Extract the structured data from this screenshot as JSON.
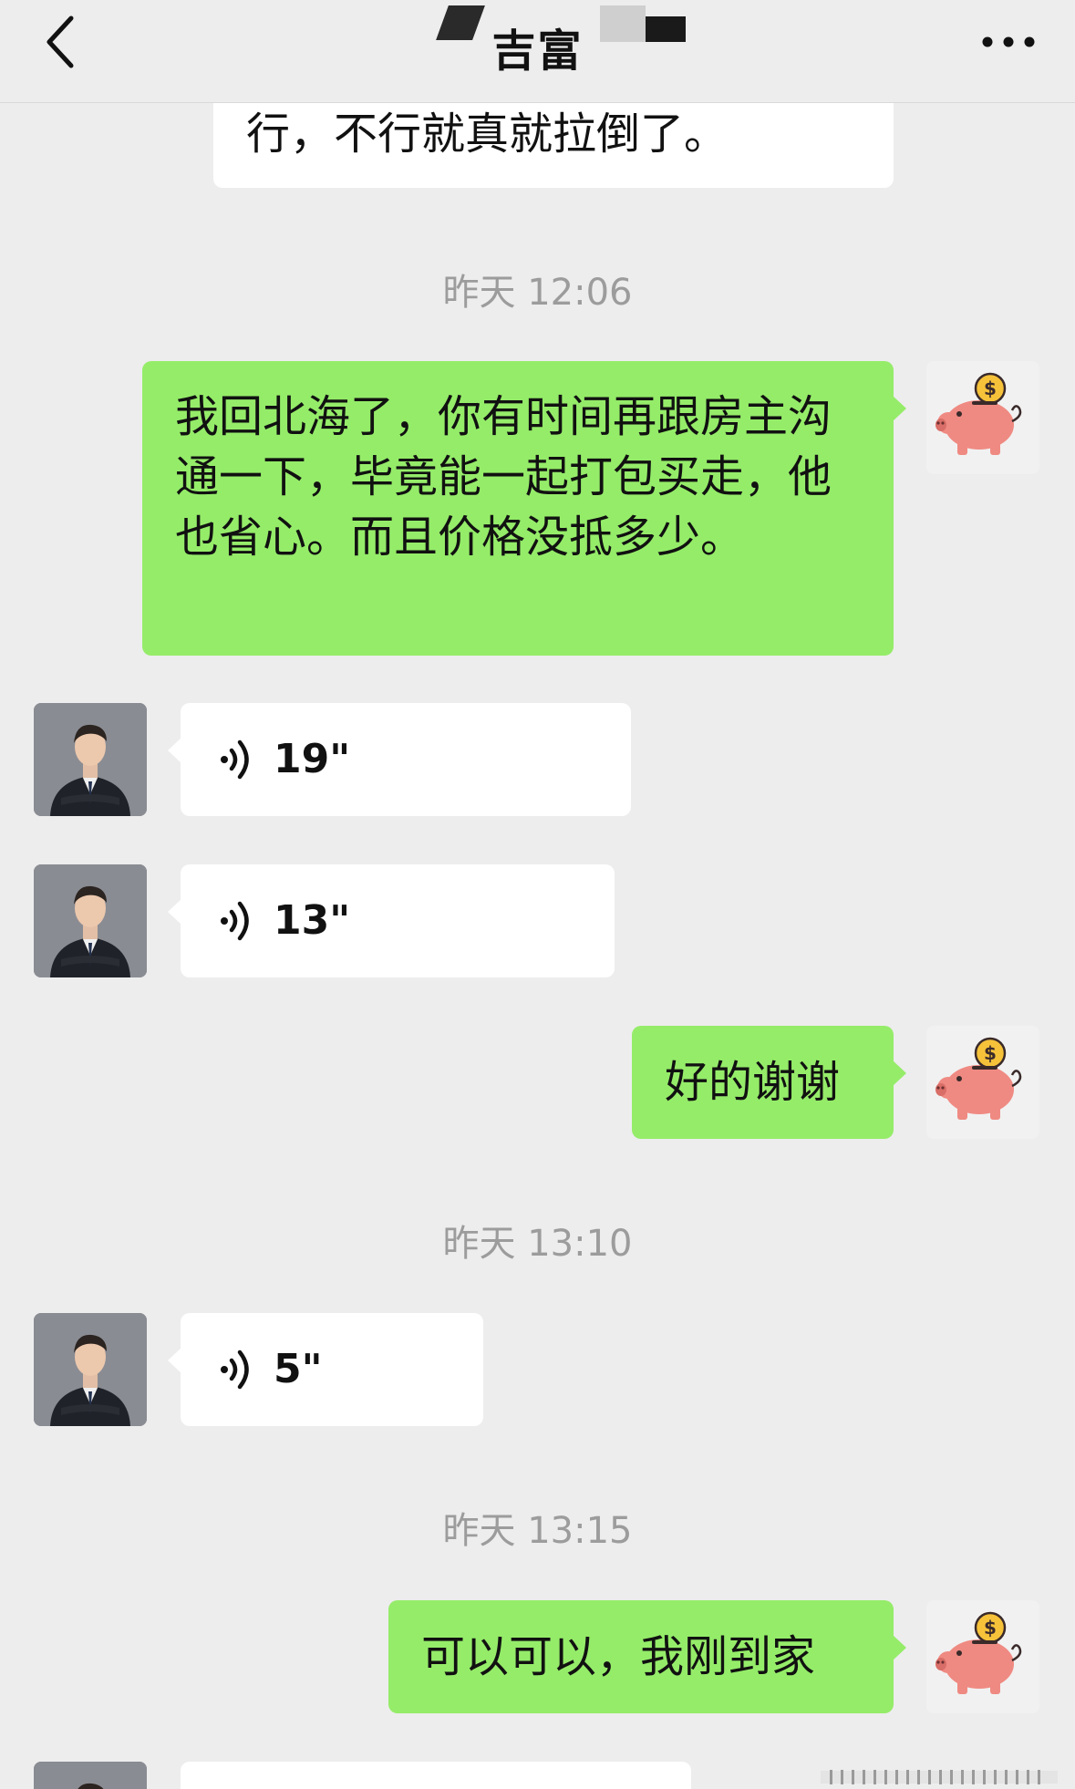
{
  "header": {
    "title": "吉富",
    "back_icon": "chevron-left-icon",
    "more_icon": "more-horizontal-icon"
  },
  "colors": {
    "background": "#ededed",
    "my_bubble": "#95ec69",
    "their_bubble": "#ffffff",
    "timestamp": "#9c9c9c"
  },
  "messages": {
    "m0": {
      "sender": "other",
      "text": "行，不行就真就拉倒了。"
    },
    "t1": "昨天 12:06",
    "m1": {
      "sender": "me",
      "text": "我回北海了，你有时间再跟房主沟通一下，毕竟能一起打包买走，他也省心。而且价格没抵多少。"
    },
    "m2": {
      "sender": "other",
      "type": "voice",
      "duration": "19\""
    },
    "m3": {
      "sender": "other",
      "type": "voice",
      "duration": "13\""
    },
    "m4": {
      "sender": "me",
      "text": "好的谢谢"
    },
    "t2": "昨天 13:10",
    "m5": {
      "sender": "other",
      "type": "voice",
      "duration": "5\""
    },
    "t3": "昨天 13:15",
    "m6": {
      "sender": "me",
      "text": "可以可以，我刚到家"
    }
  },
  "avatars": {
    "me": "piggy-bank-icon",
    "other": "man-in-suit-photo"
  }
}
